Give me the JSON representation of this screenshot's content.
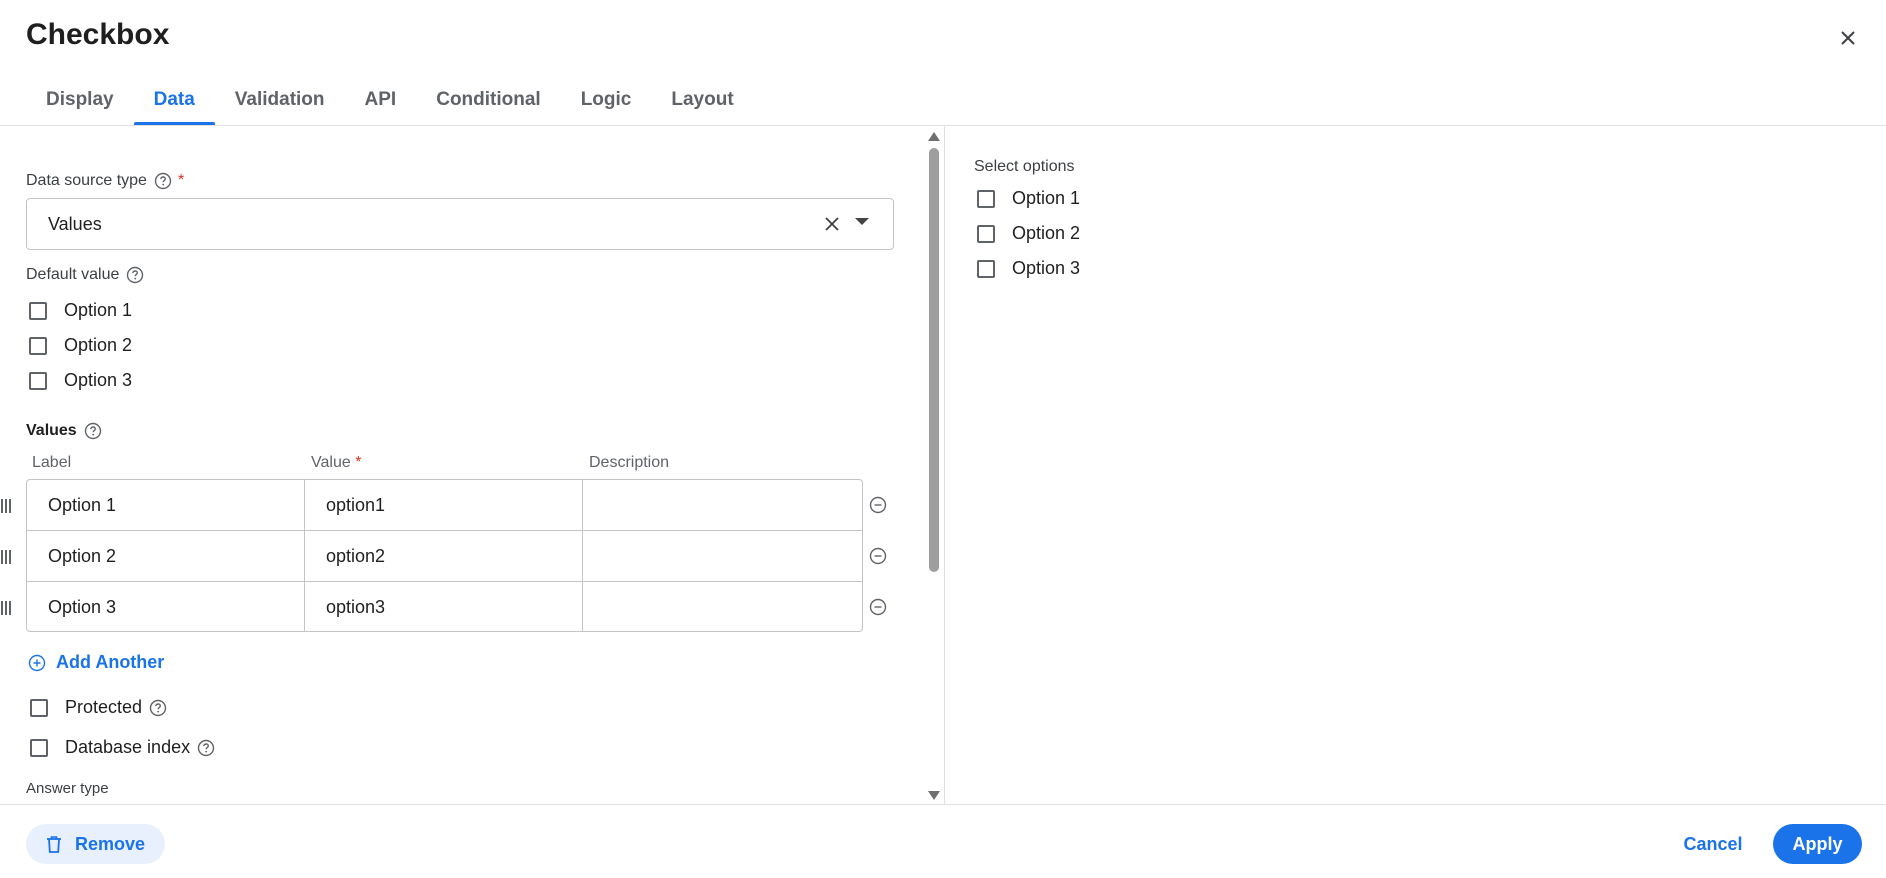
{
  "dialog": {
    "title": "Checkbox",
    "close_icon": "close-icon"
  },
  "tabs": [
    {
      "label": "Display",
      "active": false
    },
    {
      "label": "Data",
      "active": true
    },
    {
      "label": "Validation",
      "active": false
    },
    {
      "label": "API",
      "active": false
    },
    {
      "label": "Conditional",
      "active": false
    },
    {
      "label": "Logic",
      "active": false
    },
    {
      "label": "Layout",
      "active": false
    }
  ],
  "data_source": {
    "label": "Data source type",
    "required_mark": "*",
    "value": "Values"
  },
  "default_value": {
    "label": "Default value",
    "options": [
      "Option 1",
      "Option 2",
      "Option 3"
    ]
  },
  "values": {
    "title": "Values",
    "columns": {
      "label": "Label",
      "value": "Value",
      "value_required": "*",
      "description": "Description"
    },
    "rows": [
      {
        "label": "Option 1",
        "value": "option1",
        "description": ""
      },
      {
        "label": "Option 2",
        "value": "option2",
        "description": ""
      },
      {
        "label": "Option 3",
        "value": "option3",
        "description": ""
      }
    ],
    "add_label": "Add Another"
  },
  "flags": {
    "protected": "Protected",
    "database_index": "Database index"
  },
  "answer_type": {
    "label": "Answer type"
  },
  "preview": {
    "label": "Select options",
    "options": [
      "Option 1",
      "Option 2",
      "Option 3"
    ]
  },
  "footer": {
    "remove_label": "Remove",
    "cancel_label": "Cancel",
    "apply_label": "Apply"
  },
  "colors": {
    "accent": "#1a73e8",
    "required": "#d93025",
    "border": "#c4c4c4"
  }
}
